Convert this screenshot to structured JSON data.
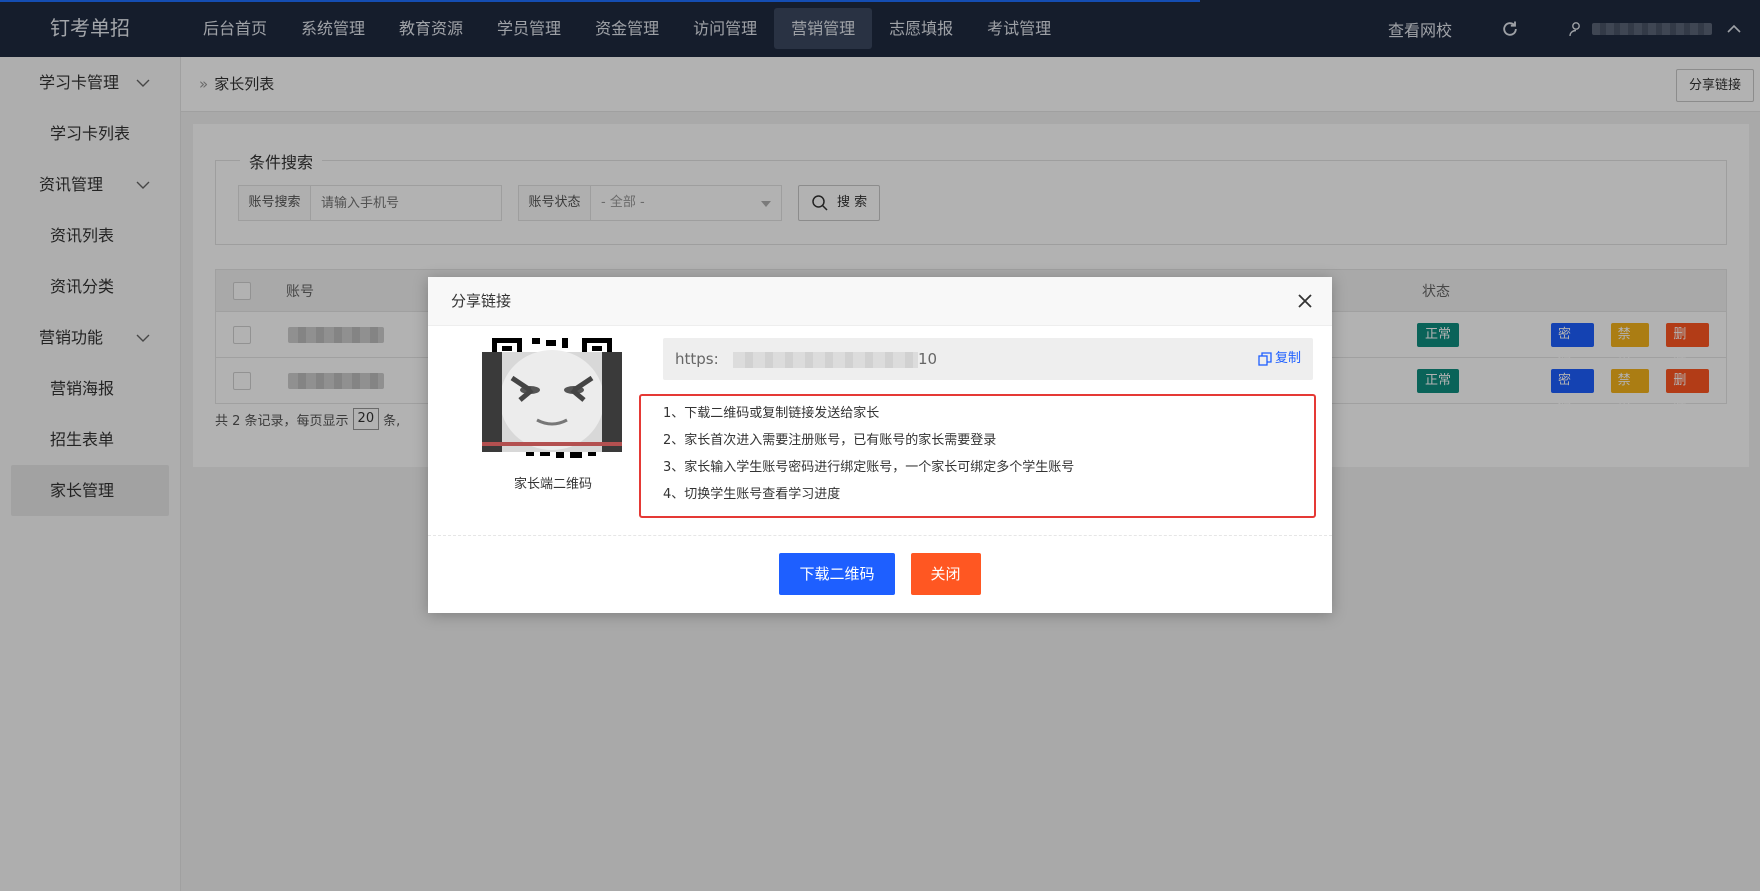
{
  "header": {
    "logo": "钉考单招",
    "nav": [
      "后台首页",
      "系统管理",
      "教育资源",
      "学员管理",
      "资金管理",
      "访问管理",
      "营销管理",
      "志愿填报",
      "考试管理"
    ],
    "active_nav": "营销管理",
    "view_site": "查看网校"
  },
  "sidebar": {
    "groups": [
      {
        "label": "学习卡管理",
        "items": [
          "学习卡列表"
        ]
      },
      {
        "label": "资讯管理",
        "items": [
          "资讯列表",
          "资讯分类"
        ]
      },
      {
        "label": "营销功能",
        "items": [
          "营销海报",
          "招生表单",
          "家长管理"
        ]
      }
    ],
    "active_item": "家长管理"
  },
  "page": {
    "breadcrumb": "家长列表",
    "share_button": "分享链接",
    "search": {
      "legend": "条件搜索",
      "account_label": "账号搜索",
      "account_placeholder": "请输入手机号",
      "status_label": "账号状态",
      "status_value": "- 全部 -",
      "search_button": "搜 索"
    },
    "table": {
      "headers": {
        "account": "账号",
        "status": "状态"
      },
      "rows": [
        {
          "status": "正常"
        },
        {
          "status": "正常"
        }
      ],
      "ops": {
        "password": "密 码",
        "ban": "禁用",
        "delete": "删 除"
      }
    },
    "pager": {
      "prefix": "共 2 条记录，每页显示",
      "page_size": "20",
      "suffix": "条,"
    }
  },
  "modal": {
    "title": "分享链接",
    "qr_caption": "家长端二维码",
    "link_prefix": "https:",
    "link_tail": "10",
    "copy_label": "复制",
    "tips": [
      "1、下载二维码或复制链接发送给家长",
      "2、家长首次进入需要注册账号，已有账号的家长需要登录",
      "3、家长输入学生账号密码进行绑定账号，一个家长可绑定多个学生账号",
      "4、切换学生账号查看学习进度"
    ],
    "download_button": "下载二维码",
    "close_button": "关闭"
  },
  "colors": {
    "header_bg": "#1f2a40",
    "primary": "#1e5fff",
    "danger": "#ff5722",
    "warn": "#f5b31c",
    "status_ok": "#0f8f80",
    "highlight_border": "#e53935"
  }
}
